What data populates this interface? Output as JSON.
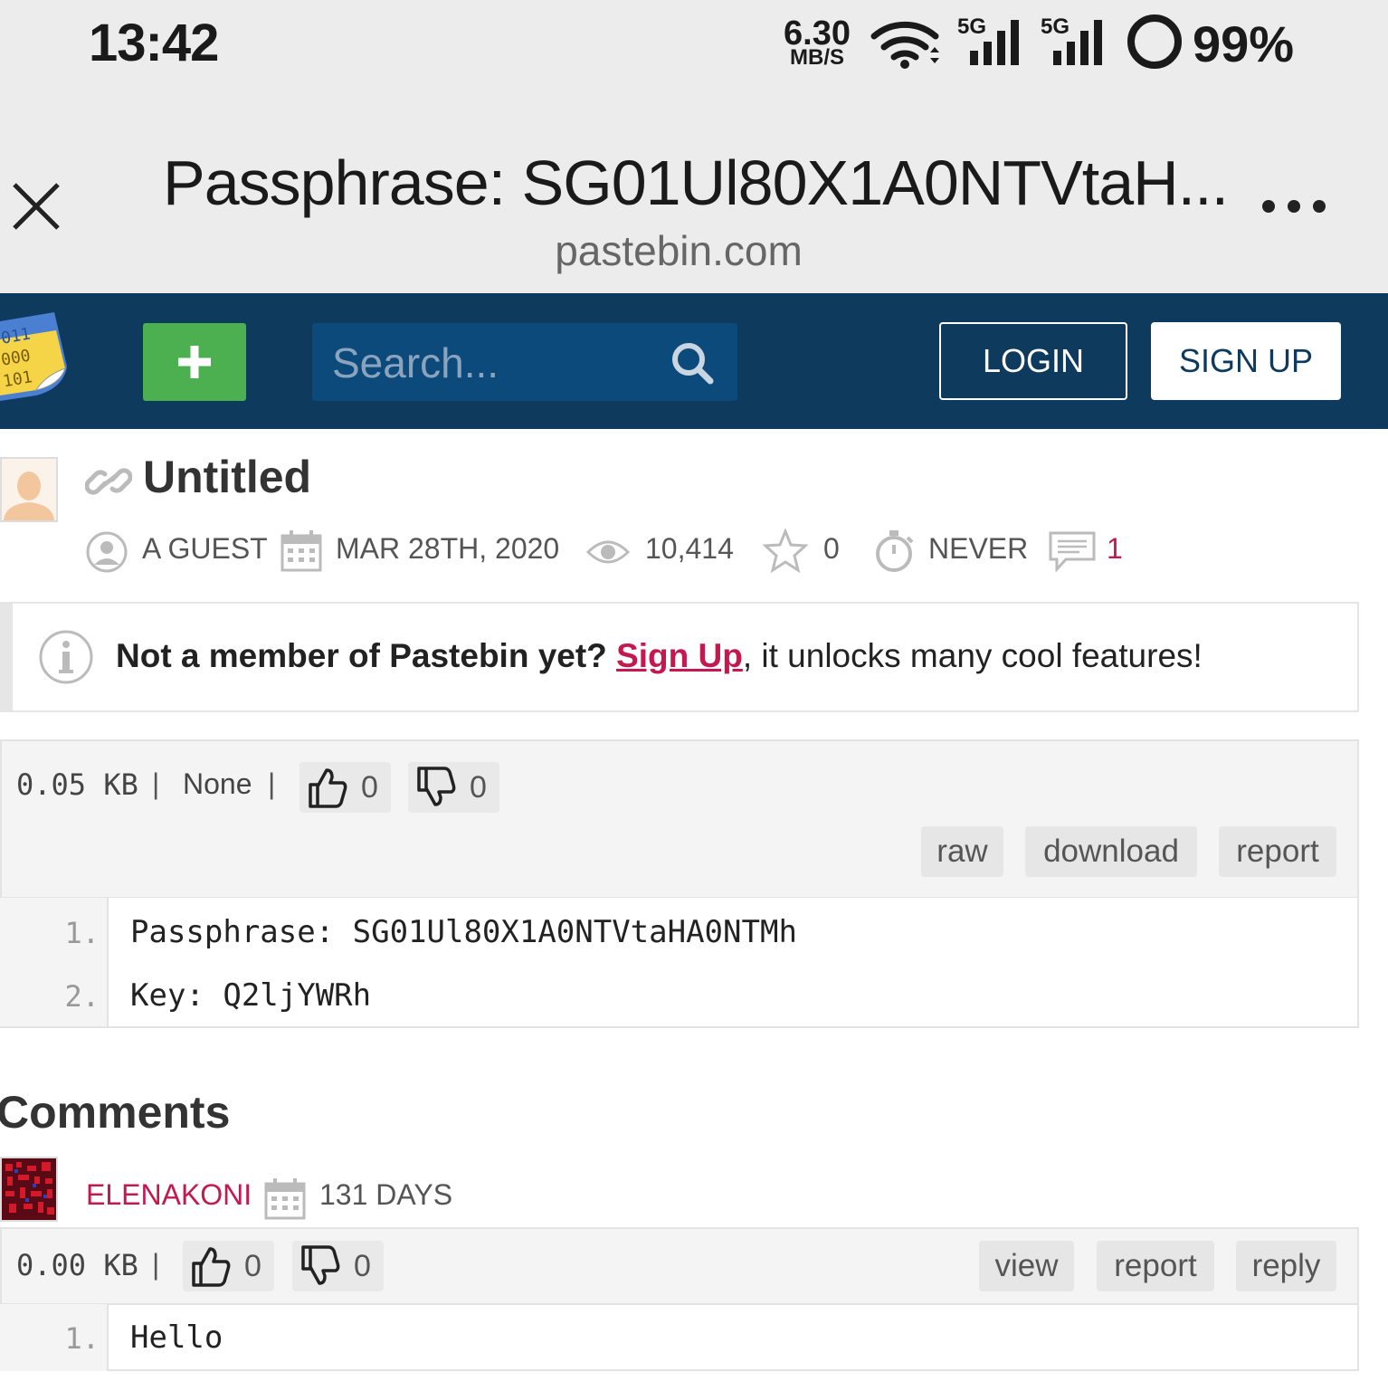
{
  "status_bar": {
    "time": "13:42",
    "net_speed_value": "6.30",
    "net_speed_unit": "MB/S",
    "signal1_label": "5G",
    "signal2_label": "5G",
    "battery": "99%"
  },
  "browser": {
    "title": "Passphrase: SG01Ul80X1A0NTVtaH...",
    "domain": "pastebin.com"
  },
  "nav": {
    "search_placeholder": "Search...",
    "login_label": "LOGIN",
    "signup_label": "SIGN UP",
    "accent_green": "#4caf50",
    "nav_bg": "#0e3a5e"
  },
  "paste": {
    "title": "Untitled",
    "author": "A GUEST",
    "date": "MAR 28TH, 2020",
    "views": "10,414",
    "stars": "0",
    "expiry": "NEVER",
    "comments_count": "1",
    "size": "0.05 KB",
    "syntax": "None",
    "likes": "0",
    "dislikes": "0",
    "actions": {
      "raw": "raw",
      "download": "download",
      "report": "report"
    },
    "lines": [
      {
        "num": "1.",
        "text": "Passphrase: SG01Ul80X1A0NTVtaHA0NTMh"
      },
      {
        "num": "2.",
        "text": "Key: Q2ljYWRh"
      }
    ]
  },
  "notice": {
    "lead": "Not a member of Pastebin yet?",
    "link": "Sign Up",
    "rest": ", it unlocks many cool features!"
  },
  "comments": {
    "heading": "Comments",
    "items": [
      {
        "user": "ELENAKONI",
        "date": "131 DAYS",
        "size": "0.00 KB",
        "likes": "0",
        "dislikes": "0",
        "actions": {
          "view": "view",
          "report": "report",
          "reply": "reply"
        },
        "lines": [
          {
            "num": "1.",
            "text": "Hello"
          }
        ]
      }
    ]
  }
}
